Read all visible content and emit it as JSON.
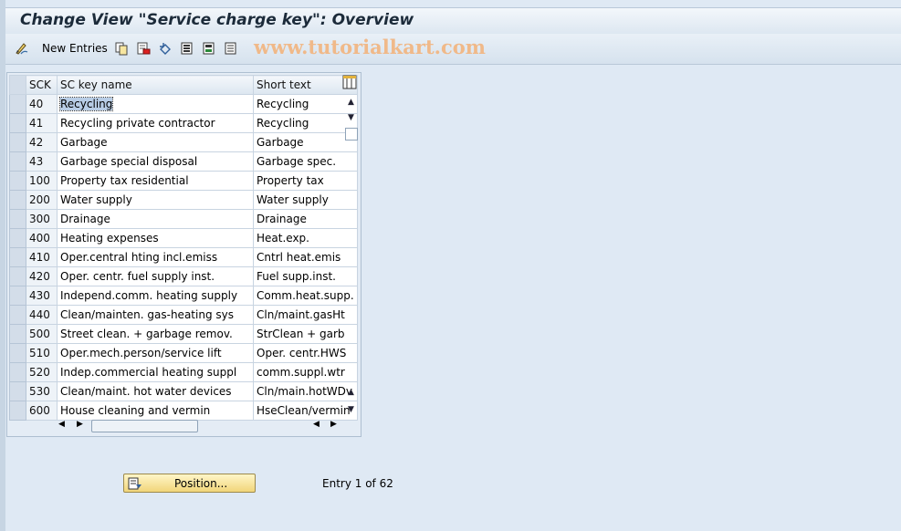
{
  "window": {
    "title": "Change View \"Service charge key\": Overview"
  },
  "toolbar": {
    "new_entries_label": "New Entries",
    "watermark": "www.tutorialkart.com",
    "icons": [
      "display-change-icon",
      "copy-icon",
      "delete-icon",
      "undo-icon",
      "select-all-icon",
      "select-block-icon",
      "deselect-all-icon"
    ]
  },
  "table": {
    "columns": [
      "SCK",
      "SC key name",
      "Short text"
    ],
    "rows": [
      {
        "sck": "40",
        "name": "Recycling",
        "short": "Recycling"
      },
      {
        "sck": "41",
        "name": "Recycling private contractor",
        "short": "Recycling"
      },
      {
        "sck": "42",
        "name": "Garbage",
        "short": "Garbage"
      },
      {
        "sck": "43",
        "name": "Garbage special disposal",
        "short": "Garbage spec."
      },
      {
        "sck": "100",
        "name": "Property tax residential",
        "short": "Property tax"
      },
      {
        "sck": "200",
        "name": "Water supply",
        "short": "Water supply"
      },
      {
        "sck": "300",
        "name": "Drainage",
        "short": "Drainage"
      },
      {
        "sck": "400",
        "name": "Heating expenses",
        "short": "Heat.exp."
      },
      {
        "sck": "410",
        "name": "Oper.central hting incl.emiss",
        "short": "Cntrl heat.emis"
      },
      {
        "sck": "420",
        "name": "Oper. centr. fuel supply inst.",
        "short": "Fuel supp.inst."
      },
      {
        "sck": "430",
        "name": "Independ.comm. heating supply",
        "short": "Comm.heat.supp."
      },
      {
        "sck": "440",
        "name": "Clean/mainten. gas-heating sys",
        "short": "Cln/maint.gasHt"
      },
      {
        "sck": "500",
        "name": "Street clean. + garbage remov.",
        "short": "StrClean + garb"
      },
      {
        "sck": "510",
        "name": "Oper.mech.person/service lift",
        "short": "Oper. centr.HWS"
      },
      {
        "sck": "520",
        "name": "Indep.commercial heating suppl",
        "short": "comm.suppl.wtr"
      },
      {
        "sck": "530",
        "name": "Clean/maint. hot water devices",
        "short": "Cln/main.hotWDv"
      },
      {
        "sck": "600",
        "name": "House cleaning and vermin",
        "short": "HseClean/vermin"
      }
    ]
  },
  "footer": {
    "position_label": "Position...",
    "entry_text": "Entry 1 of 62"
  }
}
